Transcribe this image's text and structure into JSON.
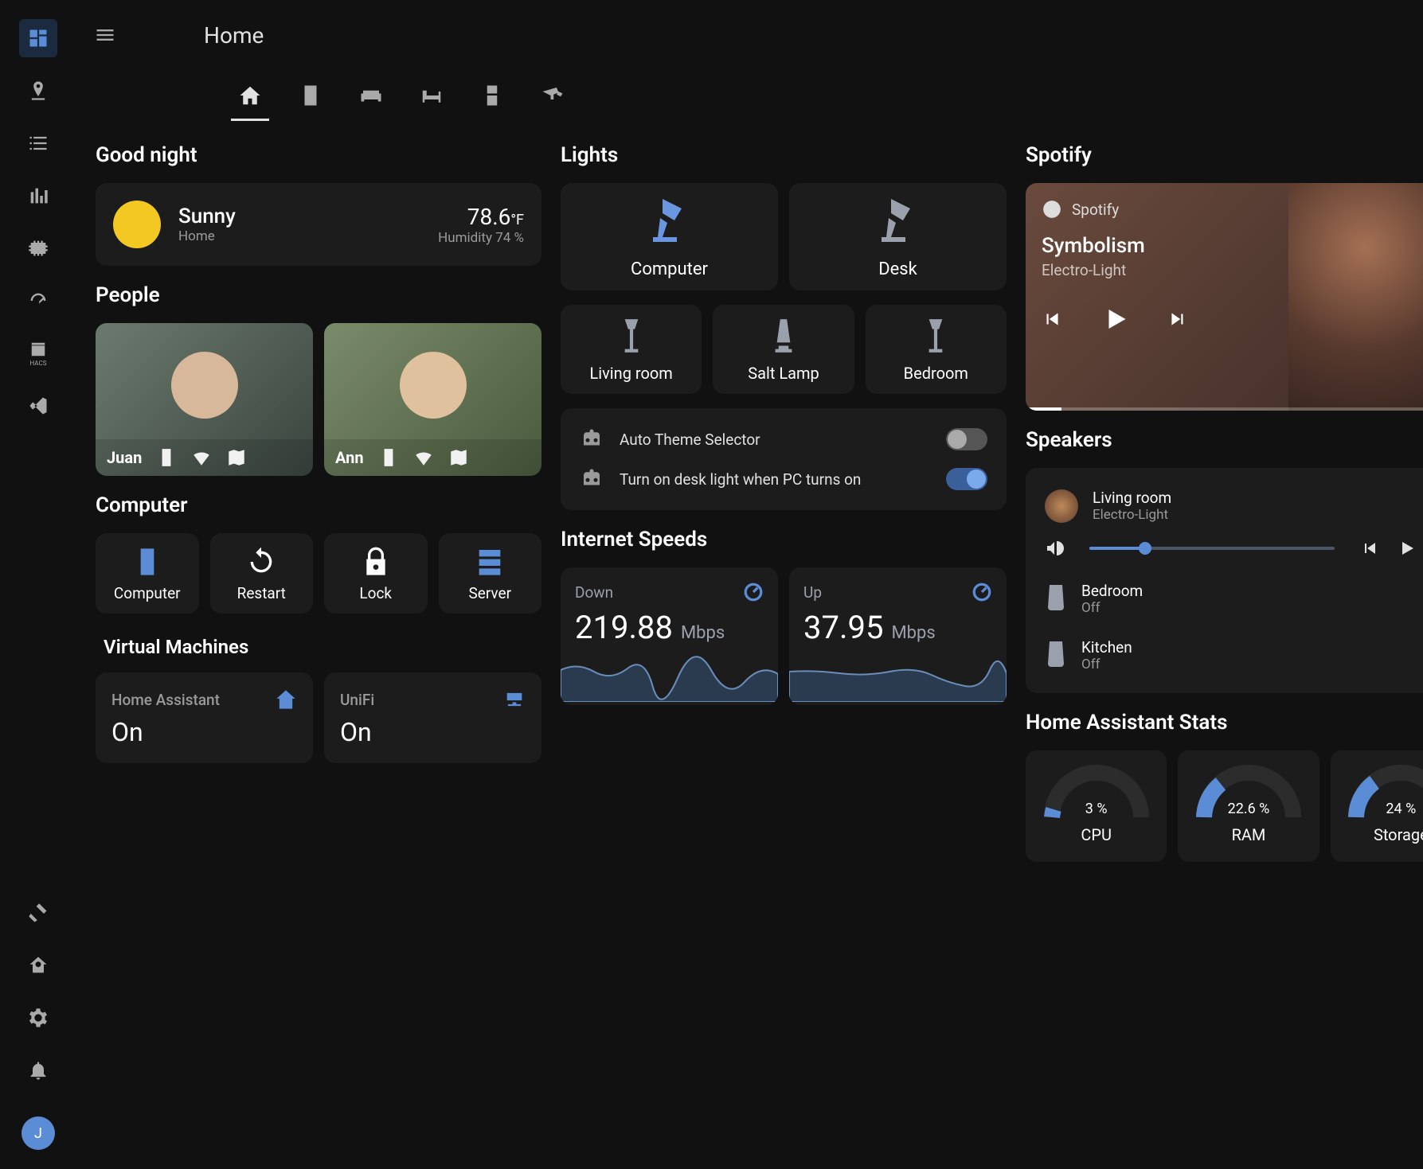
{
  "page": {
    "title": "Home"
  },
  "rail": {
    "avatar_initial": "J",
    "hacs_label": "HACS"
  },
  "greeting": "Good night",
  "weather": {
    "condition": "Sunny",
    "location": "Home",
    "temp_value": "78.6",
    "temp_unit": "°F",
    "humidity_line": "Humidity 74 %"
  },
  "sections": {
    "people": "People",
    "computer": "Computer",
    "vms": "Virtual Machines",
    "lights": "Lights",
    "internet": "Internet Speeds",
    "spotify": "Spotify",
    "speakers": "Speakers",
    "ha_stats": "Home Assistant Stats"
  },
  "people": [
    {
      "name": "Juan"
    },
    {
      "name": "Ann"
    }
  ],
  "computer_buttons": {
    "computer": "Computer",
    "restart": "Restart",
    "lock": "Lock",
    "server": "Server"
  },
  "vms": [
    {
      "name": "Home Assistant",
      "state": "On"
    },
    {
      "name": "UniFi",
      "state": "On"
    }
  ],
  "lights": {
    "computer": "Computer",
    "desk": "Desk",
    "living": "Living room",
    "salt": "Salt Lamp",
    "bedroom": "Bedroom"
  },
  "automations": [
    {
      "label": "Auto Theme Selector",
      "on": false
    },
    {
      "label": "Turn on desk light when PC turns on",
      "on": true
    }
  ],
  "internet": {
    "down": {
      "label": "Down",
      "value": "219.88",
      "unit": "Mbps"
    },
    "up": {
      "label": "Up",
      "value": "37.95",
      "unit": "Mbps"
    }
  },
  "spotify": {
    "source": "Spotify",
    "title": "Symbolism",
    "artist": "Electro-Light"
  },
  "speakers": [
    {
      "name": "Living room",
      "sub": "Electro-Light",
      "playing": true
    },
    {
      "name": "Bedroom",
      "sub": "Off",
      "playing": false
    },
    {
      "name": "Kitchen",
      "sub": "Off",
      "playing": false
    }
  ],
  "ha_stats": {
    "cpu": {
      "label": "CPU",
      "value": "3 %",
      "pct": 3
    },
    "ram": {
      "label": "RAM",
      "value": "22.6 %",
      "pct": 22.6
    },
    "storage": {
      "label": "Storage",
      "value": "24 %",
      "pct": 24
    }
  }
}
